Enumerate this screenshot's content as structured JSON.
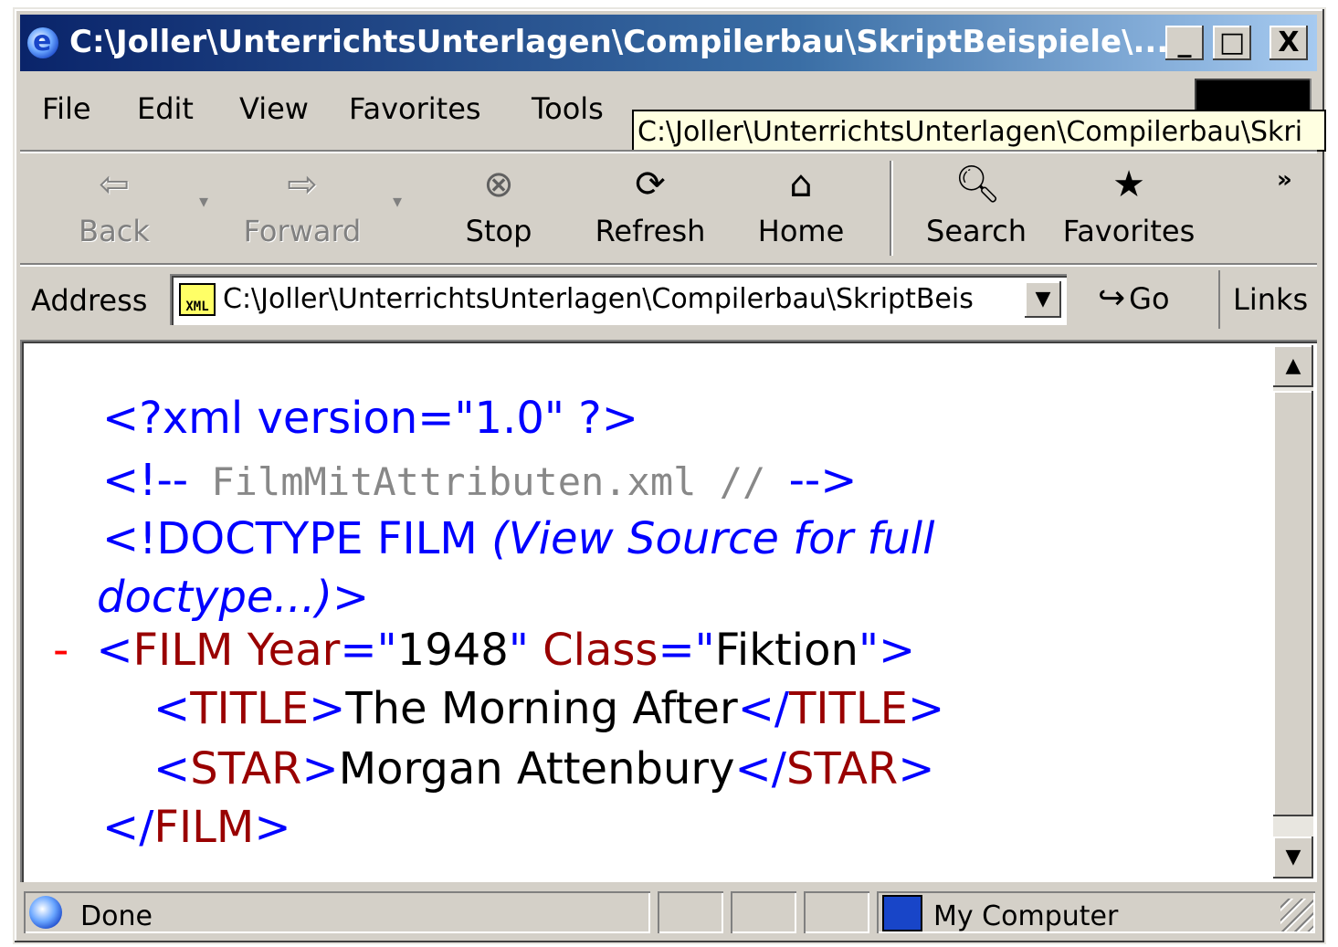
{
  "window": {
    "title": "C:\\Joller\\UnterrichtsUnterlagen\\Compilerbau\\SkriptBeispiele\\...",
    "minimize": "_",
    "maximize": "□",
    "close": "X"
  },
  "menu": {
    "file": "File",
    "edit": "Edit",
    "view": "View",
    "favorites": "Favorites",
    "tools": "Tools"
  },
  "tooltip": "C:\\Joller\\UnterrichtsUnterlagen\\Compilerbau\\Skri",
  "toolbar": {
    "back": "Back",
    "forward": "Forward",
    "stop": "Stop",
    "refresh": "Refresh",
    "home": "Home",
    "search": "Search",
    "favorites": "Favorites",
    "more": "»"
  },
  "address": {
    "label": "Address",
    "value": "C:\\Joller\\UnterrichtsUnterlagen\\Compilerbau\\SkriptBeis",
    "icon_text": "XML",
    "go": "Go",
    "links": "Links"
  },
  "xml": {
    "decl": "<?xml version=\"1.0\" ?>",
    "comment_open": "<!--",
    "comment_text": " FilmMitAttributen.xml // ",
    "comment_close": "-->",
    "doctype_open": "<!DOCTYPE FILM ",
    "doctype_note_1": "(View Source for full",
    "doctype_note_2": "doctype...)",
    "doctype_close": ">",
    "collapse": "-",
    "film_lt": "<",
    "film_tag": "FILM Year",
    "eq1": "=\"",
    "year": "1948",
    "q1": "\"",
    "class_attr": " Class",
    "eq2": "=\"",
    "class_val": "Fiktion",
    "q2": "\">",
    "title_open_lt": "<",
    "title_tag": "TITLE",
    "title_open_gt": ">",
    "title_text": "The Morning After",
    "title_close_lt": "</",
    "title_close_tag": "TITLE",
    "title_close_gt": ">",
    "star_open_lt": "<",
    "star_tag": "STAR",
    "star_open_gt": ">",
    "star_text": "Morgan Attenbury",
    "star_close_lt": "</",
    "star_close_tag": "STAR",
    "star_close_gt": ">",
    "film_close_lt": "</",
    "film_close_tag": "FILM",
    "film_close_gt": ">"
  },
  "status": {
    "text": "Done",
    "zone": "My Computer"
  }
}
